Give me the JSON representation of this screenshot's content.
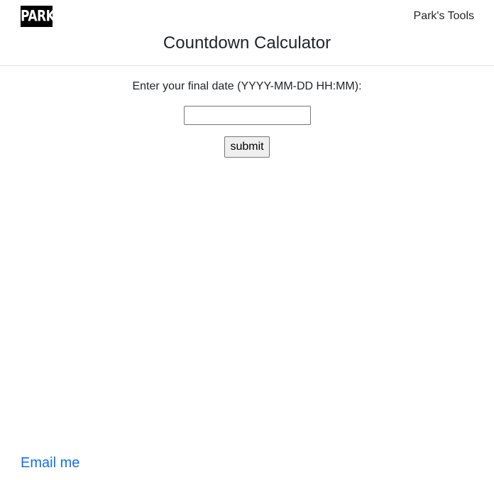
{
  "header": {
    "logo_text": "PARK",
    "nav_link": "Park's Tools",
    "title": "Countdown Calculator"
  },
  "form": {
    "label": "Enter your final date (YYYY-MM-DD HH:MM):",
    "input_value": "",
    "submit_label": "submit"
  },
  "footer": {
    "email_link": "Email me"
  },
  "colors": {
    "link": "#0d6efd",
    "text": "#212529",
    "logo_bg": "#000000"
  }
}
